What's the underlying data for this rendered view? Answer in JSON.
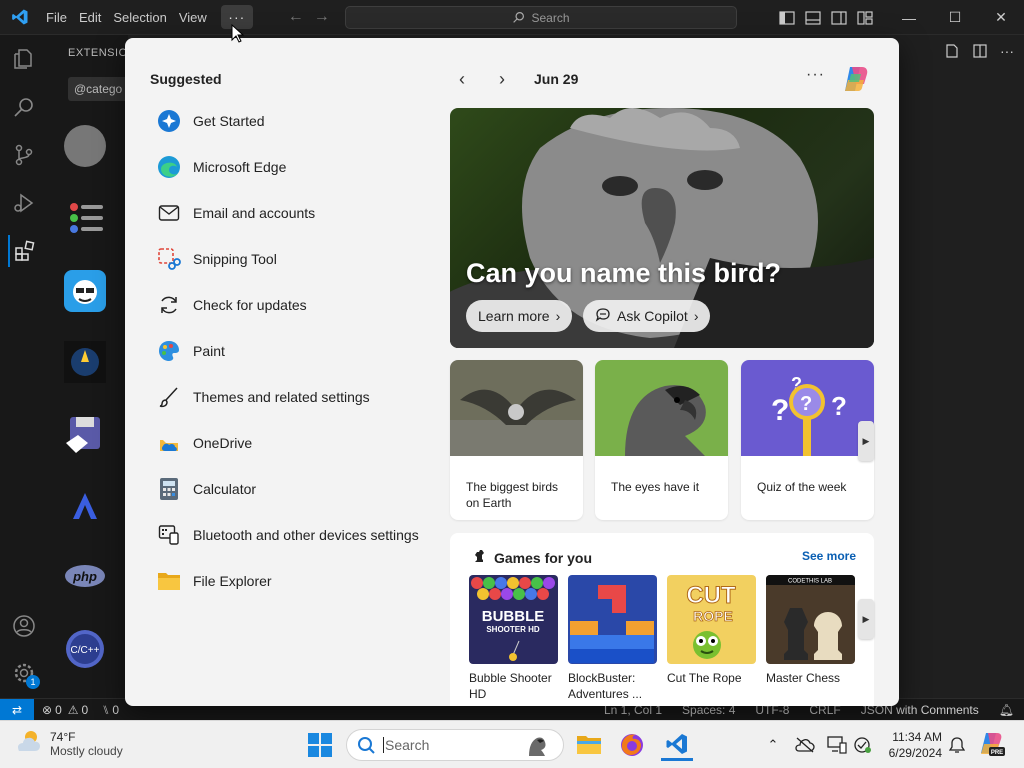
{
  "vscode": {
    "menu": [
      "File",
      "Edit",
      "Selection",
      "View"
    ],
    "more_label": "···",
    "search_label": "Search",
    "sidebar_title": "EXTENSIONS",
    "sidebar_search": "@catego",
    "status": {
      "errors": "0",
      "warnings": "0",
      "ports": "0",
      "position": "Ln 1, Col 1",
      "spaces": "Spaces: 4",
      "encoding": "UTF-8",
      "eol": "CRLF",
      "language": "JSON with Comments"
    }
  },
  "widgets": {
    "suggested_title": "Suggested",
    "suggested": [
      {
        "label": "Get Started",
        "icon": "get-started-icon"
      },
      {
        "label": "Microsoft Edge",
        "icon": "edge-icon"
      },
      {
        "label": "Email and accounts",
        "icon": "mail-icon"
      },
      {
        "label": "Snipping Tool",
        "icon": "snipping-tool-icon"
      },
      {
        "label": "Check for updates",
        "icon": "refresh-icon"
      },
      {
        "label": "Paint",
        "icon": "paint-icon"
      },
      {
        "label": "Themes and related settings",
        "icon": "brush-icon"
      },
      {
        "label": "OneDrive",
        "icon": "onedrive-icon"
      },
      {
        "label": "Calculator",
        "icon": "calculator-icon"
      },
      {
        "label": "Bluetooth and other devices settings",
        "icon": "devices-icon"
      },
      {
        "label": "File Explorer",
        "icon": "folder-icon"
      }
    ],
    "date": "Jun 29",
    "more": "···",
    "hero": {
      "title": "Can you name this bird?",
      "learn_more": "Learn more",
      "ask_copilot": "Ask Copilot"
    },
    "cards": [
      {
        "text": "The biggest birds on Earth"
      },
      {
        "text": "The eyes have it"
      },
      {
        "text": "Quiz of the week"
      }
    ],
    "games": {
      "title": "Games for you",
      "see_more": "See more",
      "items": [
        {
          "label": "Bubble Shooter HD",
          "art_line1": "BUBBLE",
          "art_line2": "SHOOTER HD"
        },
        {
          "label": "BlockBuster: Adventures ..."
        },
        {
          "label": "Cut The Rope",
          "art_line1": "CUT",
          "art_line2": "ROPE"
        },
        {
          "label": "Master Chess",
          "art_line1": "CODETHIS LAB"
        }
      ]
    }
  },
  "taskbar": {
    "weather_temp": "74°F",
    "weather_desc": "Mostly cloudy",
    "search_placeholder": "Search",
    "time": "11:34 AM",
    "date": "6/29/2024"
  },
  "colors": {
    "vscode_accent": "#0078d4",
    "link": "#0a5fb3",
    "flyout_bg": "#f3f3f3"
  }
}
